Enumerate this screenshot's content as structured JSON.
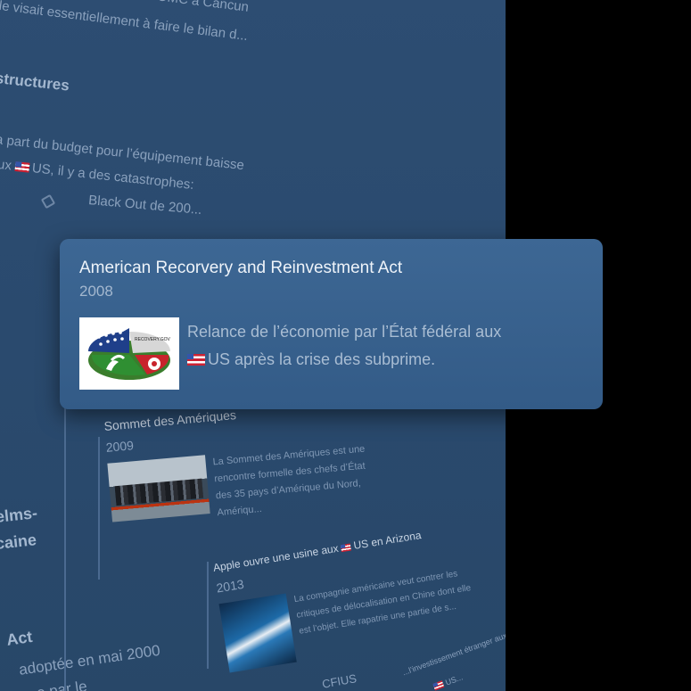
{
  "background": {
    "lines": [
      {
        "id": "l1",
        "text": "de l’OMC à Cancun"
      },
      {
        "id": "l2",
        "text": "le visait essentiellement à faire le bilan d..."
      },
      {
        "id": "l3",
        "text": "structures"
      },
      {
        "id": "l4",
        "text": "a part du budget pour l’équipement baisse"
      },
      {
        "id": "l5a",
        "text": "ux "
      },
      {
        "id": "l5b",
        "text": "US, il y a des catastrophes:"
      },
      {
        "id": "l6",
        "text": "Black Out de 200..."
      },
      {
        "id": "l7",
        "text": "elms-"
      },
      {
        "id": "l8",
        "text": "caine"
      },
      {
        "id": "l9",
        "text": "Act"
      },
      {
        "id": "l10",
        "text": "adoptée en mai 2000"
      },
      {
        "id": "l11",
        "text": "e par le"
      }
    ],
    "cards": [
      {
        "title": "Sommet des Amériques",
        "year": "2009",
        "desc": "La Sommet des Amériques est une rencontre formelle des chefs d’État des 35 pays d’Amérique du Nord, Amériqu..."
      },
      {
        "title_pre": "Apple ouvre une usine aux ",
        "title_post": "US en Arizona",
        "year": "2013",
        "desc": "La compagnie américaine veut contrer les critiques de délocalisation en Chine dont elle est l’objet. Elle rapatrie une partie de s..."
      }
    ],
    "bottom": {
      "cfius": "CFIUS",
      "right": "...l’investissement étranger aux",
      "right2": "US..."
    }
  },
  "popup": {
    "title": "American Recorvery and Reinvestment Act",
    "year": "2008",
    "description_line1": "Relance de l’économie par l’État fédéral aux",
    "description_line2": "US après la crise des subprime.",
    "logo_text": "RECOVERY.GOV"
  },
  "colors": {
    "panel": "#2a4a6e",
    "popup": "#3a6490",
    "black": "#000000"
  }
}
